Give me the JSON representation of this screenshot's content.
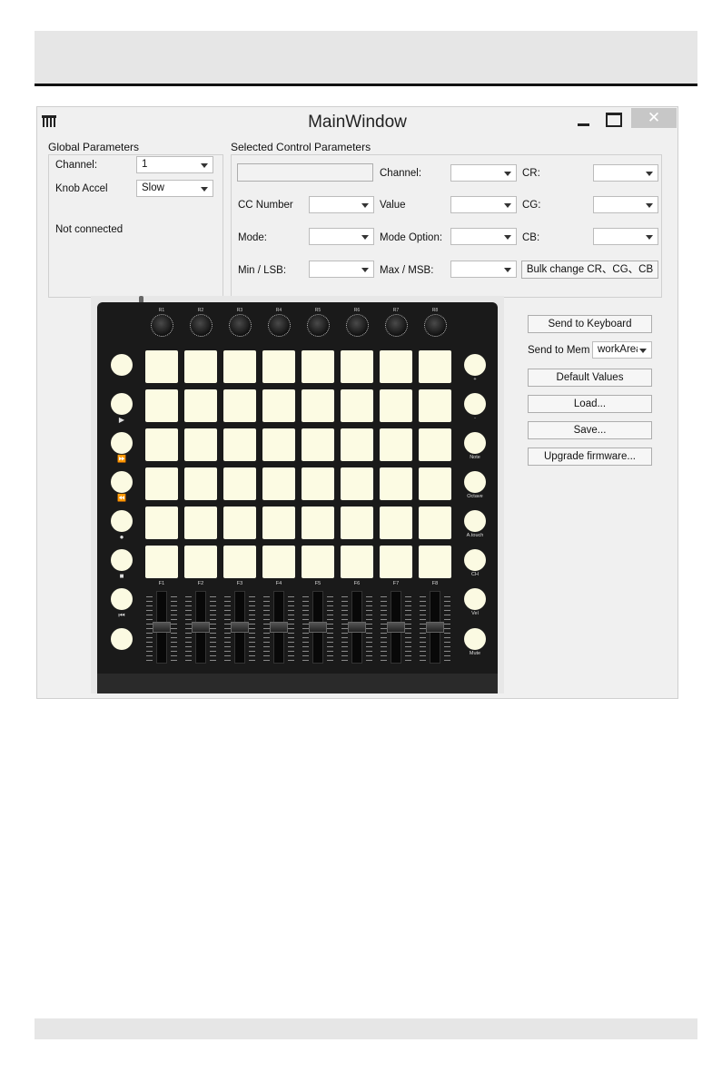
{
  "window": {
    "title": "MainWindow",
    "close_glyph": "✕"
  },
  "global": {
    "group_label": "Global Parameters",
    "channel_label": "Channel:",
    "channel_value": "1",
    "knob_accel_label": "Knob Accel",
    "knob_accel_value": "Slow",
    "status": "Not connected"
  },
  "selected": {
    "group_label": "Selected Control Parameters",
    "name_value": "",
    "cc_number_label": "CC Number",
    "mode_label": "Mode:",
    "min_lsb_label": "Min / LSB:",
    "channel_label": "Channel:",
    "value_label": "Value",
    "mode_option_label": "Mode Option:",
    "max_msb_label": "Max / MSB:",
    "cr_label": "CR:",
    "cg_label": "CG:",
    "cb_label": "CB:",
    "bulk_change_label": "Bulk change CR、CG、CB"
  },
  "actions": {
    "send_to_keyboard": "Send to Keyboard",
    "send_to_mem_label": "Send to Mem",
    "send_to_mem_value": "workArea",
    "default_values": "Default Values",
    "load": "Load...",
    "save": "Save...",
    "upgrade_firmware": "Upgrade firmware..."
  },
  "controller": {
    "knobs": [
      "R1",
      "R2",
      "R3",
      "R4",
      "R5",
      "R6",
      "R7",
      "R8"
    ],
    "faders": [
      "F1",
      "F2",
      "F3",
      "F4",
      "F5",
      "F6",
      "F7",
      "F8"
    ],
    "left_buttons": [
      "",
      "▶",
      "⏩",
      "⏪",
      "●",
      "■",
      "⏮",
      ""
    ],
    "right_buttons": [
      "+",
      "-",
      "Note",
      "Octave",
      "A.touch",
      "CH",
      "Vel",
      "Mute"
    ],
    "pad_rows": 6,
    "pad_cols": 8,
    "pad_color": "#fcfbe3"
  },
  "icons": {
    "app": "piano-keys-icon",
    "minimize": "minimize-icon",
    "maximize": "maximize-icon",
    "close": "close-icon",
    "dropdown": "chevron-down-icon"
  }
}
